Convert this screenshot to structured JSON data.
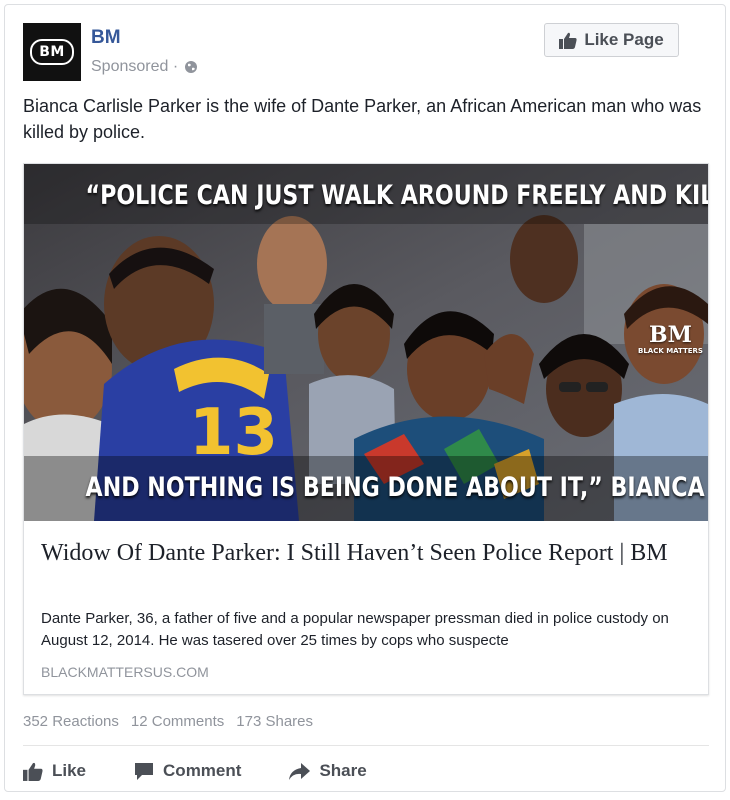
{
  "post": {
    "page_name": "BM",
    "avatar_text": "BM",
    "sponsored_label": "Sponsored ·",
    "privacy_icon": "globe-icon",
    "like_page_label": "Like Page",
    "text": "Bianca Carlisle Parker is the wife of Dante Parker, an African American man who was killed by police."
  },
  "attachment": {
    "image_quote_top": "“POLICE CAN JUST WALK AROUND FREELY AND KILL",
    "image_quote_bottom": "AND NOTHING IS BEING DONE ABOUT IT,” BIANCA PARKER",
    "watermark_logo": "BM",
    "watermark_text": "BLACK MATTERS",
    "title": "Widow Of Dante Parker: I Still Haven’t Seen Police Report | BM",
    "description": "Dante Parker, 36, a father of five and a popular newspaper pressman died in police custody on August 12, 2014. He was tasered over 25 times by cops who suspecte",
    "domain": "BLACKMATTERSUS.COM"
  },
  "stats": {
    "reactions": "352 Reactions",
    "comments": "12 Comments",
    "shares": "173 Shares"
  },
  "actions": {
    "like": "Like",
    "comment": "Comment",
    "share": "Share"
  },
  "colors": {
    "link_blue": "#365899",
    "meta_gray": "#90949c",
    "text": "#1d2129",
    "button_gray": "#4b4f56"
  }
}
